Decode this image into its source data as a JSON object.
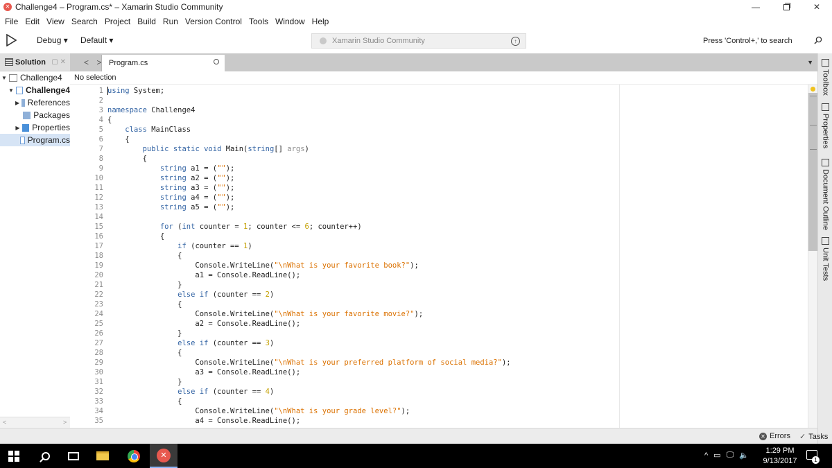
{
  "window": {
    "title": "Challenge4 – Program.cs* – Xamarin Studio Community",
    "app_badge": "✕",
    "minimize": "—",
    "close": "✕"
  },
  "menu": [
    "File",
    "Edit",
    "View",
    "Search",
    "Project",
    "Build",
    "Run",
    "Version Control",
    "Tools",
    "Window",
    "Help"
  ],
  "toolbar": {
    "config": "Debug ▾",
    "target": "Default ▾",
    "status_text": "Xamarin Studio Community",
    "search_hint": "Press 'Control+,' to search"
  },
  "solution_pad": {
    "title": "Solution",
    "controls": "▢ ✕",
    "items": [
      {
        "label": "Challenge4",
        "arrow": "▼",
        "indent": 0,
        "bold": false,
        "selected": false,
        "icon": "solution-icon"
      },
      {
        "label": "Challenge4",
        "arrow": "▼",
        "indent": 1,
        "bold": true,
        "selected": false,
        "icon": "project-icon"
      },
      {
        "label": "References",
        "arrow": "▶",
        "indent": 2,
        "bold": false,
        "selected": false,
        "icon": "references-folder-icon"
      },
      {
        "label": "Packages",
        "arrow": "",
        "indent": 2,
        "bold": false,
        "selected": false,
        "icon": "packages-folder-icon"
      },
      {
        "label": "Properties",
        "arrow": "▶",
        "indent": 2,
        "bold": false,
        "selected": false,
        "icon": "properties-folder-icon"
      },
      {
        "label": "Program.cs",
        "arrow": "",
        "indent": 2,
        "bold": false,
        "selected": true,
        "icon": "csharp-file-icon"
      }
    ],
    "scroll_left": "<",
    "scroll_right": ">"
  },
  "editor": {
    "nav_back": "<",
    "nav_forward": ">",
    "tab_label": "Program.cs",
    "tab_dropdown": "▼",
    "path_selection": "No selection"
  },
  "code_lines": [
    {
      "n": "1",
      "t": "using System;"
    },
    {
      "n": "2",
      "t": ""
    },
    {
      "n": "3",
      "t": "namespace Challenge4"
    },
    {
      "n": "4",
      "t": "{"
    },
    {
      "n": "5",
      "t": "    class MainClass"
    },
    {
      "n": "6",
      "t": "    {"
    },
    {
      "n": "7",
      "t": "        public static void Main(string[] args)"
    },
    {
      "n": "8",
      "t": "        {"
    },
    {
      "n": "9",
      "t": "            string a1 = (\"\");"
    },
    {
      "n": "10",
      "t": "            string a2 = (\"\");"
    },
    {
      "n": "11",
      "t": "            string a3 = (\"\");"
    },
    {
      "n": "12",
      "t": "            string a4 = (\"\");"
    },
    {
      "n": "13",
      "t": "            string a5 = (\"\");"
    },
    {
      "n": "14",
      "t": ""
    },
    {
      "n": "15",
      "t": "            for (int counter = 1; counter <= 6; counter++)"
    },
    {
      "n": "16",
      "t": "            {"
    },
    {
      "n": "17",
      "t": "                if (counter == 1)"
    },
    {
      "n": "18",
      "t": "                {"
    },
    {
      "n": "19",
      "t": "                    Console.WriteLine(\"\\nWhat is your favorite book?\");"
    },
    {
      "n": "20",
      "t": "                    a1 = Console.ReadLine();"
    },
    {
      "n": "21",
      "t": "                }"
    },
    {
      "n": "22",
      "t": "                else if (counter == 2)"
    },
    {
      "n": "23",
      "t": "                {"
    },
    {
      "n": "24",
      "t": "                    Console.WriteLine(\"\\nWhat is your favorite movie?\");"
    },
    {
      "n": "25",
      "t": "                    a2 = Console.ReadLine();"
    },
    {
      "n": "26",
      "t": "                }"
    },
    {
      "n": "27",
      "t": "                else if (counter == 3)"
    },
    {
      "n": "28",
      "t": "                {"
    },
    {
      "n": "29",
      "t": "                    Console.WriteLine(\"\\nWhat is your preferred platform of social media?\");"
    },
    {
      "n": "30",
      "t": "                    a3 = Console.ReadLine();"
    },
    {
      "n": "31",
      "t": "                }"
    },
    {
      "n": "32",
      "t": "                else if (counter == 4)"
    },
    {
      "n": "33",
      "t": "                {"
    },
    {
      "n": "34",
      "t": "                    Console.WriteLine(\"\\nWhat is your grade level?\");"
    },
    {
      "n": "35",
      "t": "                    a4 = Console.ReadLine();"
    }
  ],
  "syntax_colors": {
    "keyword": "#3364a4",
    "type": "#3364a4",
    "string": "#db7100",
    "number": "#c4a000",
    "identifier": "#222222",
    "param": "#8f8f8f"
  },
  "right_dock": [
    {
      "label": "Toolbox",
      "icon": "toolbox-icon"
    },
    {
      "label": "Properties",
      "icon": "properties-icon"
    },
    {
      "label": "Document Outline",
      "icon": "document-outline-icon"
    },
    {
      "label": "Unit Tests",
      "icon": "unit-tests-icon"
    }
  ],
  "statusbar": {
    "errors_label": "Errors",
    "errors_icon_glyph": "✕",
    "tasks_label": "Tasks",
    "tasks_icon_glyph": "✓"
  },
  "taskbar": {
    "tray_glyphs": [
      "^",
      "▭",
      "🖵",
      "🔈"
    ],
    "time": "1:29 PM",
    "date": "9/13/2017",
    "notification_count": "1",
    "xamarin_glyph": "✕"
  }
}
